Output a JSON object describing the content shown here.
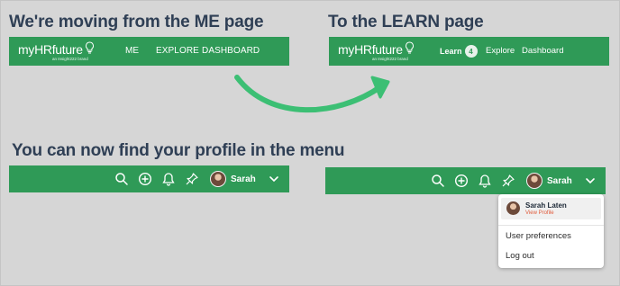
{
  "headings": {
    "from": "We're moving from the ME page",
    "to": "To the LEARN page",
    "profile": "You can now find your profile in the menu"
  },
  "logo": {
    "my": "my",
    "hr": "HR",
    "future": "future",
    "tagline": "an Insight222 brand"
  },
  "old_nav": {
    "items": [
      "ME",
      "EXPLORE",
      "DASHBOARD"
    ]
  },
  "new_nav": {
    "learn": "Learn",
    "learn_badge": "4",
    "explore": "Explore",
    "dashboard": "Dashboard"
  },
  "user_bar": {
    "name": "Sarah"
  },
  "menu": {
    "full_name": "Sarah Laten",
    "view_profile": "View Profile",
    "user_preferences": "User preferences",
    "log_out": "Log out"
  },
  "colors": {
    "bar": "#2f9a57",
    "arrow": "#3cbf74",
    "heading": "#2f3f55",
    "profile_link": "#e05a3a"
  },
  "icons": [
    "search-icon",
    "plus-circle-icon",
    "bell-icon",
    "pin-icon",
    "chevron-down-icon",
    "lightbulb-icon"
  ]
}
